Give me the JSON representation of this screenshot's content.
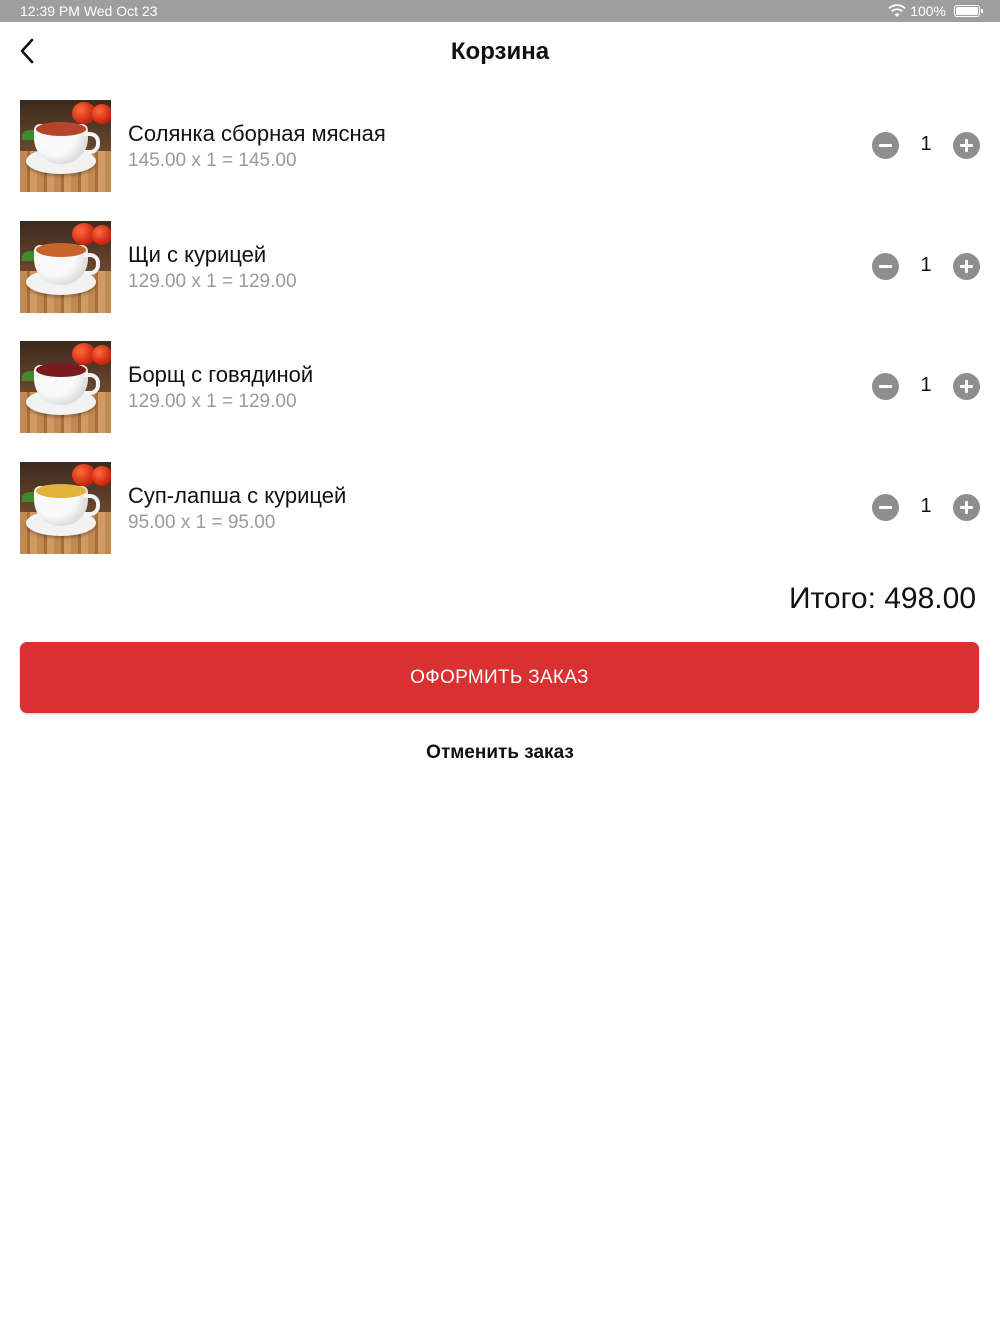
{
  "status_bar": {
    "time_date": "12:39 PM Wed Oct 23",
    "battery": "100%",
    "icons": [
      "wifi-icon",
      "battery-icon"
    ]
  },
  "header": {
    "title": "Корзина",
    "back_icon": "chevron-left-icon"
  },
  "cart": {
    "items": [
      {
        "name": "Солянка сборная мясная",
        "price_line": "145.00 x 1 = 145.00",
        "quantity": "1",
        "soup_color": "#b5442a"
      },
      {
        "name": "Щи с курицей",
        "price_line": "129.00 x 1 = 129.00",
        "quantity": "1",
        "soup_color": "#c9652a"
      },
      {
        "name": "Борщ с говядиной",
        "price_line": "129.00 x 1 = 129.00",
        "quantity": "1",
        "soup_color": "#7a1a1f"
      },
      {
        "name": "Суп-лапша с курицей",
        "price_line": "95.00 x 1 = 95.00",
        "quantity": "1",
        "soup_color": "#e0b43a"
      }
    ],
    "total_label": "Итого: 498.00"
  },
  "actions": {
    "checkout_label": "ОФОРМИТЬ ЗАКАЗ",
    "cancel_label": "Отменить заказ"
  },
  "colors": {
    "accent": "#d93131",
    "status_bar": "#9e9e9e",
    "muted_text": "#9a9a9a",
    "qty_button": "#8e8e8e"
  }
}
